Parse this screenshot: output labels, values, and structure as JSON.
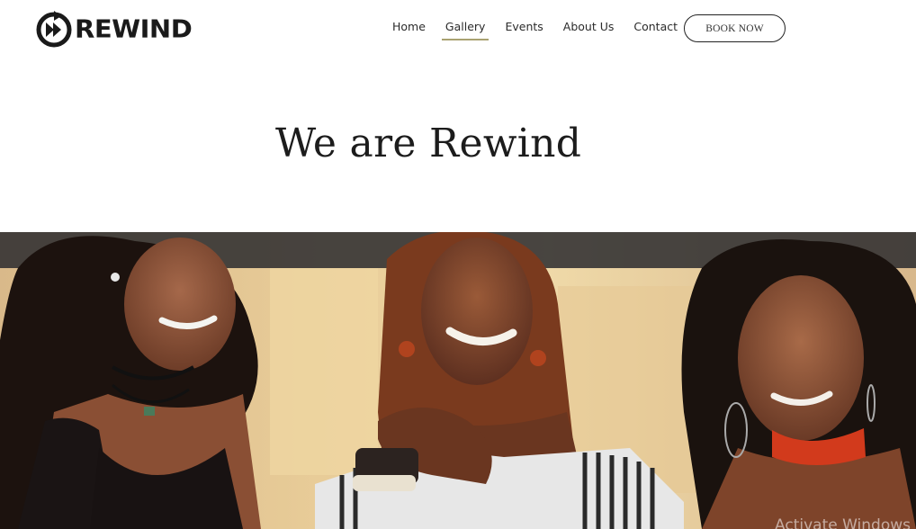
{
  "brand": {
    "logo_text": "REWIND",
    "logo_icon": "play-rewind-circle-icon"
  },
  "nav": {
    "items": [
      {
        "label": "Home",
        "active": false
      },
      {
        "label": "Gallery",
        "active": true
      },
      {
        "label": "Events",
        "active": false
      },
      {
        "label": "About Us",
        "active": false
      },
      {
        "label": "Contact",
        "active": false
      }
    ],
    "active_underline_color": "#a9a271"
  },
  "cta": {
    "label": "BOOK NOW"
  },
  "hero": {
    "title": "We are Rewind"
  },
  "photo": {
    "description_icon": "group-photo-three-women"
  },
  "os_watermark": "Activate Windows"
}
